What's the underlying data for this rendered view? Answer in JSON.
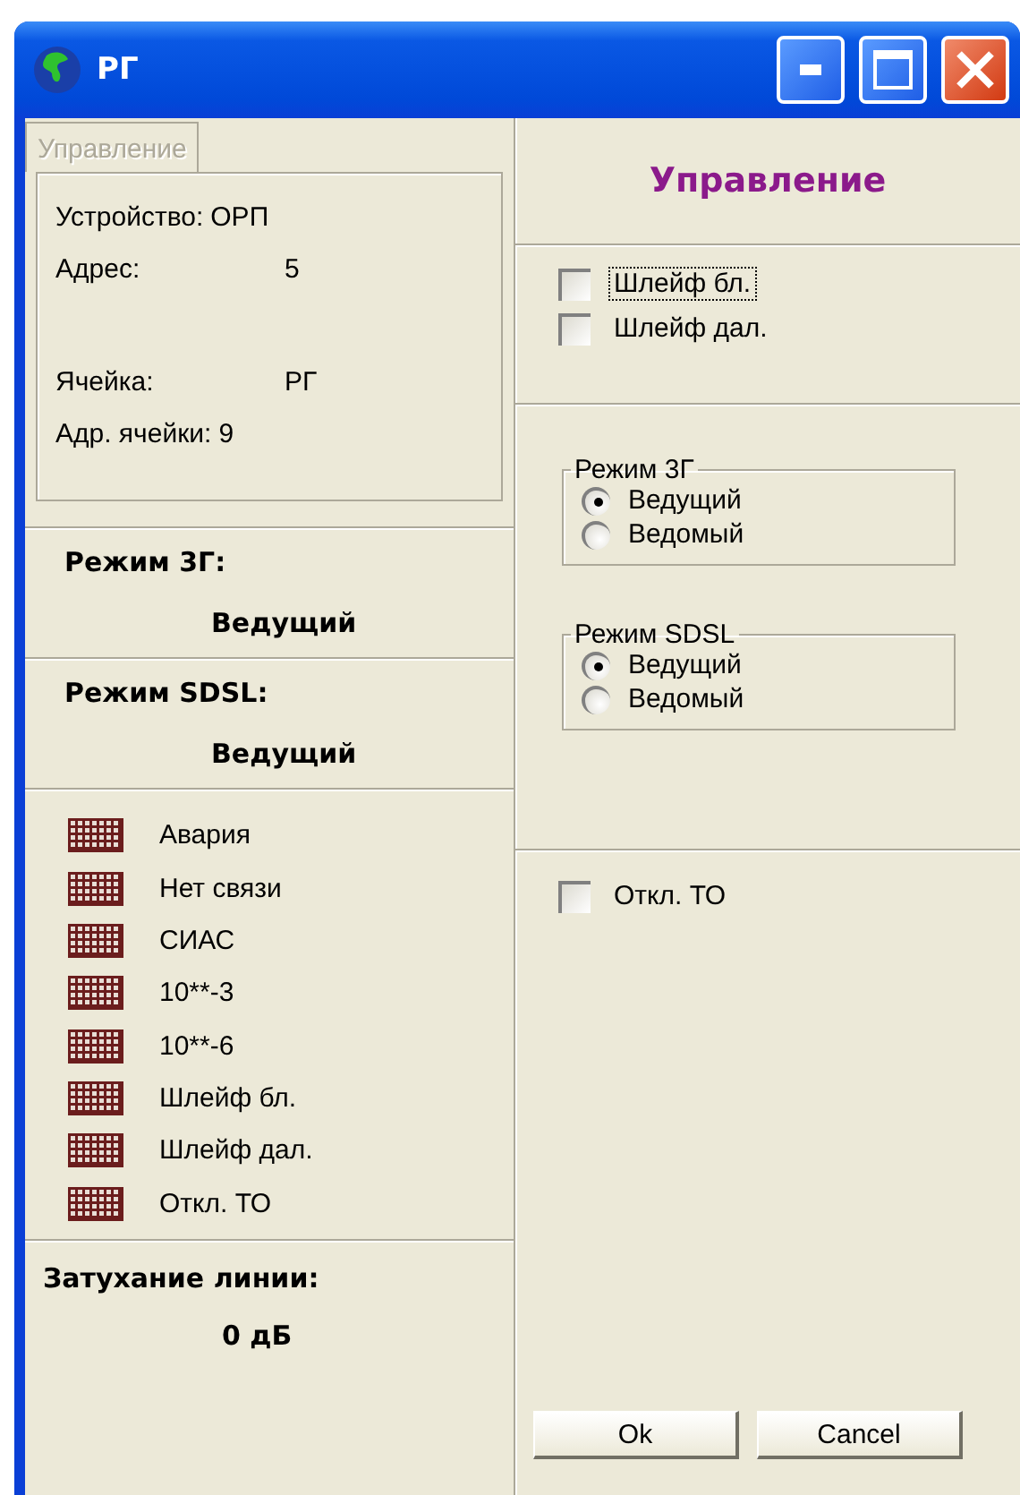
{
  "window": {
    "title": "РГ"
  },
  "title_buttons": [
    {
      "kind": "minimize"
    },
    {
      "kind": "maximize"
    },
    {
      "kind": "close"
    }
  ],
  "info_tab": {
    "label": "Управление",
    "disabled": true
  },
  "device_info": [
    {
      "label": "Устройство:",
      "value": "ОРП"
    },
    {
      "label": "Адрес:",
      "value": "5"
    }
  ],
  "cell_info": [
    {
      "label": "Ячейка:",
      "value": "РГ"
    },
    {
      "label": "Адр. ячейки:",
      "value": "9"
    }
  ],
  "modes": [
    {
      "label": "Режим 3Г:",
      "value": "Ведущий"
    },
    {
      "label": "Режим SDSL:",
      "value": "Ведущий"
    }
  ],
  "indicators": [
    {
      "label": "Авария"
    },
    {
      "label": "Нет связи"
    },
    {
      "label": "СИАС"
    },
    {
      "label": "10**-3"
    },
    {
      "label": "10**-6"
    },
    {
      "label": "Шлейф бл."
    },
    {
      "label": "Шлейф дал."
    },
    {
      "label": "Откл. ТО"
    }
  ],
  "attenuation": {
    "label": "Затухание линии:",
    "value": "0 дБ"
  },
  "control_title": "Управление",
  "loop_checks": [
    {
      "label": "Шлейф бл.",
      "checked": false,
      "focused": true
    },
    {
      "label": "Шлейф дал.",
      "checked": false,
      "focused": false
    }
  ],
  "mode_groups": [
    {
      "title": "Режим 3Г",
      "options": [
        {
          "label": "Ведущий",
          "selected": true
        },
        {
          "label": "Ведомый",
          "selected": false
        }
      ]
    },
    {
      "title": "Режим SDSL",
      "options": [
        {
          "label": "Ведущий",
          "selected": true
        },
        {
          "label": "Ведомый",
          "selected": false
        }
      ]
    }
  ],
  "to_check": {
    "label": "Откл. ТО",
    "checked": false,
    "focused": false
  },
  "buttons": [
    "Ok",
    "Cancel"
  ]
}
